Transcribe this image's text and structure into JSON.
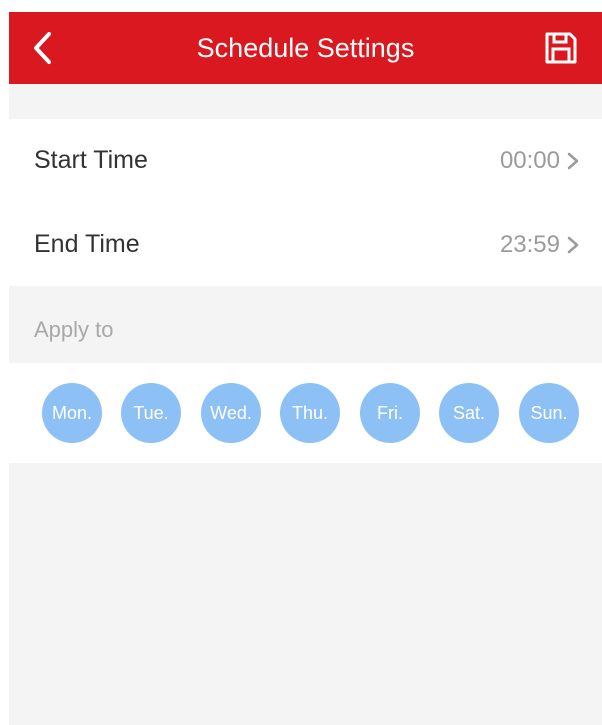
{
  "header": {
    "title": "Schedule Settings",
    "background_color": "#d9181f",
    "back_icon": "chevron-left-icon",
    "save_icon": "floppy-disk-icon"
  },
  "time_settings": {
    "start": {
      "label": "Start Time",
      "value": "00:00"
    },
    "end": {
      "label": "End Time",
      "value": "23:59"
    }
  },
  "apply_to": {
    "label": "Apply to",
    "days": [
      "Mon.",
      "Tue.",
      "Wed.",
      "Thu.",
      "Fri.",
      "Sat.",
      "Sun."
    ],
    "day_color": "#8dc1f5"
  }
}
